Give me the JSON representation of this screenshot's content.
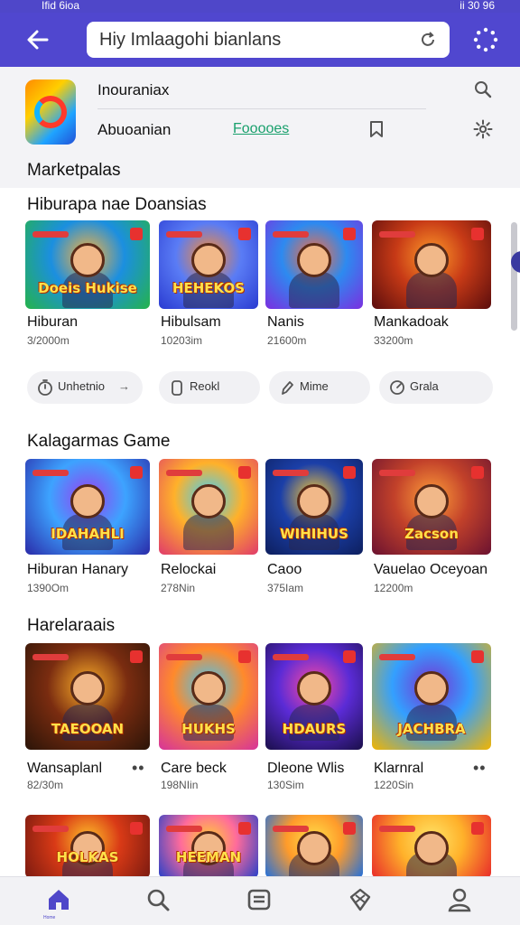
{
  "status_bar": {
    "time": "Ifid 6ioa",
    "sys": "ii 30 96"
  },
  "header": {
    "search_value": "Hiy  Imlaagohi bianlans",
    "back_icon": "arrow-left-icon",
    "refresh_icon": "refresh-icon",
    "loader_icon": "loading-spinner-icon"
  },
  "app_card": {
    "name": "Inouraniax",
    "developer": "Abuoanian",
    "follow_label": "Fooooes",
    "section_label": "Marketpalas"
  },
  "sections": [
    {
      "title": "Hiburapa nae Doansias",
      "items": [
        {
          "title": "Hiburan",
          "sub": "3/2000m",
          "art": "Doeis Hukise",
          "colors": [
            "#25b34a",
            "#1b8fe0",
            "#ffb23a"
          ]
        },
        {
          "title": "Hibulsam",
          "sub": "10203im",
          "art": "HEHEKOS",
          "colors": [
            "#2a3bd1",
            "#5a7cf5",
            "#ff8b2b"
          ]
        },
        {
          "title": "Nanis",
          "sub": "21600m",
          "art": "",
          "colors": [
            "#7b2fe0",
            "#2d8af0",
            "#ff6b3a"
          ]
        },
        {
          "title": "Mankadoak",
          "sub": "33200m",
          "art": "",
          "colors": [
            "#5b0d0d",
            "#c73a16",
            "#ff9b2a"
          ]
        }
      ]
    },
    {
      "title": "Kalagarmas Game",
      "items": [
        {
          "title": "Hiburan Hanary",
          "sub": "1390Om",
          "art": "IDAHAHLI",
          "colors": [
            "#2a2aa8",
            "#3da3ff",
            "#9a3df0"
          ]
        },
        {
          "title": "Relockai",
          "sub": "278Nin",
          "art": "",
          "colors": [
            "#e03a6b",
            "#ffb12a",
            "#3ad0ff"
          ]
        },
        {
          "title": "Caoo",
          "sub": "375Iam",
          "art": "WIHIHUS",
          "colors": [
            "#0d1f5e",
            "#1b3fa8",
            "#ffcc33"
          ]
        },
        {
          "title": "Vauelao Oceyoan",
          "sub": "12200m",
          "art": "Zacson",
          "colors": [
            "#6b1230",
            "#c2412a",
            "#ff9f3a"
          ]
        }
      ]
    },
    {
      "title": "Harelaraais",
      "items": [
        {
          "title": "Wansaplanl",
          "sub": "82/30m",
          "art": "TAEOOAN",
          "colors": [
            "#2b1408",
            "#7a2c10",
            "#ffb22a"
          ]
        },
        {
          "title": "Care beck",
          "sub": "198NIin",
          "art": "HUKHS",
          "colors": [
            "#d6339b",
            "#ff8a2b",
            "#39c6ff"
          ]
        },
        {
          "title": "Dleone Wlis",
          "sub": "130Sim",
          "art": "HDAURS",
          "colors": [
            "#1a0f4a",
            "#5b2bd6",
            "#ff4aa2"
          ]
        },
        {
          "title": "Klarnral",
          "sub": "1220Sin",
          "art": "JACHBRA",
          "colors": [
            "#f2b400",
            "#33a0ff",
            "#7a2fd1"
          ]
        }
      ]
    },
    {
      "items": [
        {
          "art": "HOLKAS",
          "colors": [
            "#7a1a10",
            "#d93a16",
            "#ffc22a"
          ]
        },
        {
          "art": "HEEMAN",
          "colors": [
            "#2540c9",
            "#ff6b9b",
            "#ffcf33"
          ]
        },
        {
          "art": "",
          "colors": [
            "#1d6fe0",
            "#ff9b2a",
            "#ffe14a"
          ]
        },
        {
          "art": "",
          "colors": [
            "#e82a2a",
            "#ffb12a",
            "#ffe66a"
          ]
        }
      ]
    }
  ],
  "filter_chips": [
    {
      "label": "Unhetnio",
      "arrow": "→",
      "icon": "timer-icon"
    },
    {
      "label": "Reokl",
      "icon": "tag-icon"
    },
    {
      "label": "Mime",
      "icon": "pencil-icon"
    },
    {
      "label": "Grala",
      "icon": "gauge-icon"
    }
  ],
  "bottom_nav": {
    "items": [
      "home-icon",
      "search-icon",
      "library-icon",
      "offers-icon",
      "profile-icon"
    ],
    "active_label": "Home"
  },
  "colors": {
    "accent": "#5047cf",
    "link": "#1aa06d"
  }
}
